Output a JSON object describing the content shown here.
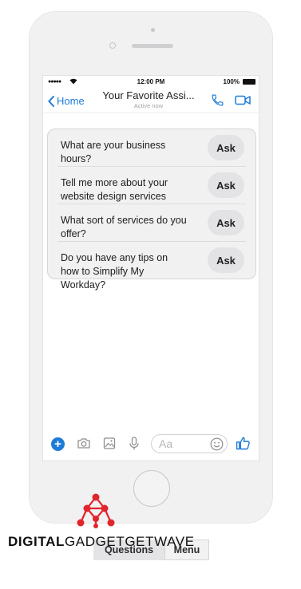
{
  "status_bar": {
    "signal": "●●●●●",
    "time": "12:00 PM",
    "battery_pct": "100%"
  },
  "header": {
    "back_label": "Home",
    "title": "Your Favorite Assi...",
    "subtitle": "Active now"
  },
  "quick_questions": [
    {
      "question": "What are your business hours?",
      "action": "Ask"
    },
    {
      "question": "Tell me more about your website design services",
      "action": "Ask"
    },
    {
      "question": "What sort of services do you offer?",
      "action": "Ask"
    },
    {
      "question": "Do you have any tips on how to Simplify My Workday?",
      "action": "Ask"
    }
  ],
  "composer": {
    "add_symbol": "+",
    "placeholder": "Aa"
  },
  "bottom_tabs": {
    "questions": "Questions",
    "menu": "Menu"
  },
  "watermark": {
    "part1": "DIGITAL",
    "part2": "GADGETGETWAVE"
  },
  "colors": {
    "accent": "#1f7bd8",
    "watermark_red": "#e0262b"
  }
}
